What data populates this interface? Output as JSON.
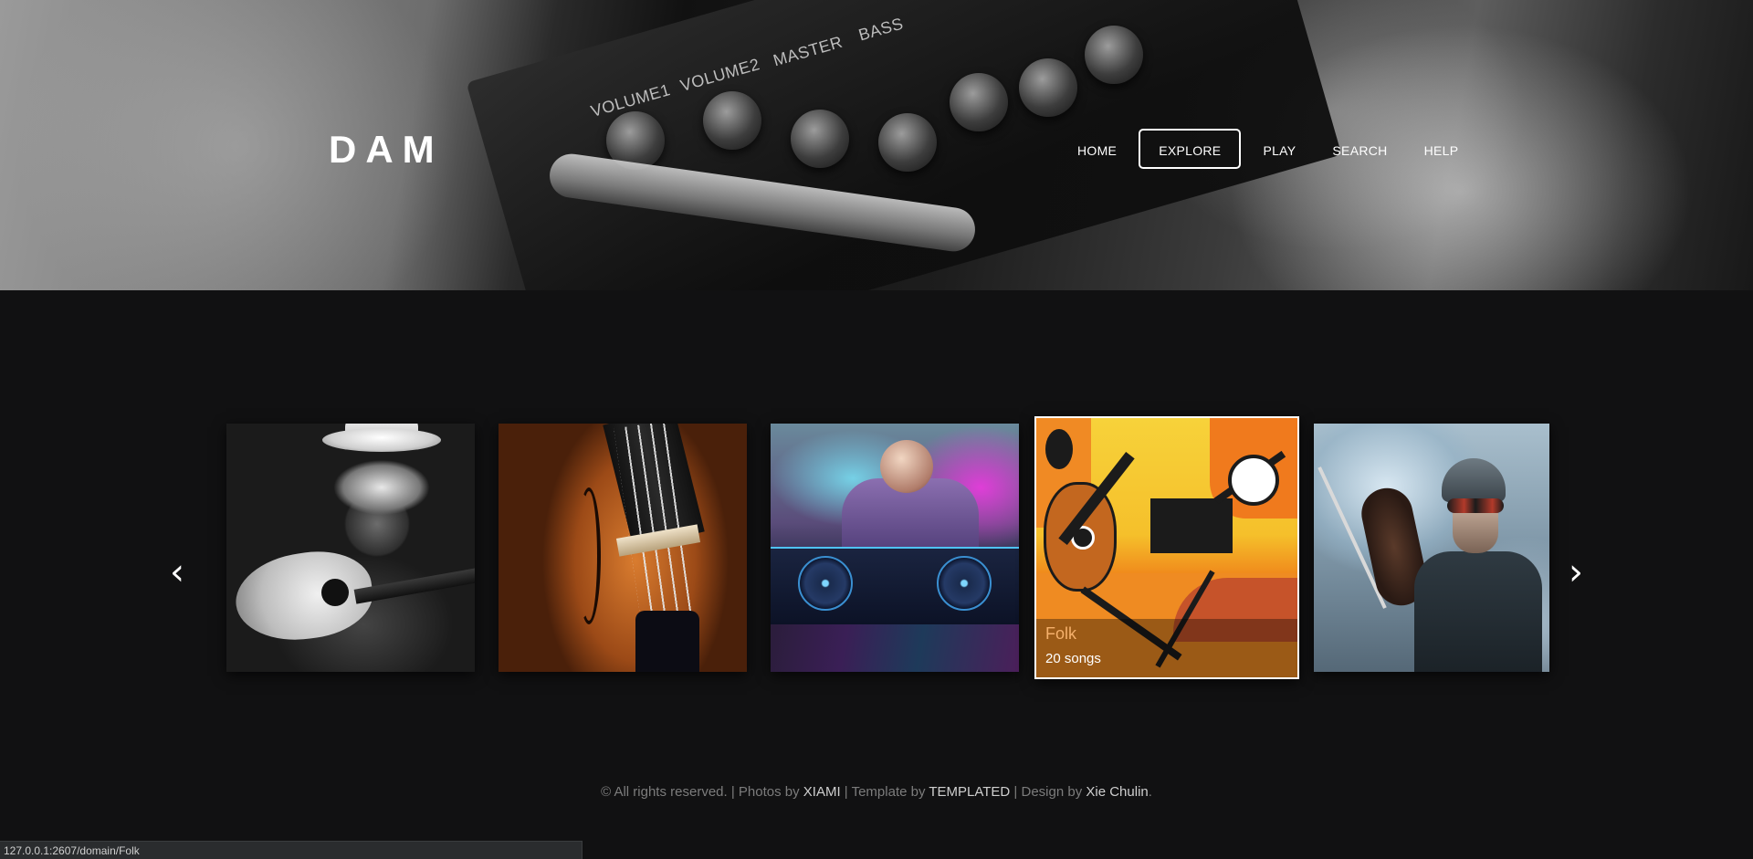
{
  "header": {
    "logo": "DAM",
    "knob_labels": [
      "VOLUME1",
      "VOLUME2",
      "MASTER",
      "BASS"
    ],
    "nav": [
      {
        "label": "HOME",
        "active": false
      },
      {
        "label": "EXPLORE",
        "active": true
      },
      {
        "label": "PLAY",
        "active": false
      },
      {
        "label": "SEARCH",
        "active": false
      },
      {
        "label": "HELP",
        "active": false
      }
    ]
  },
  "carousel": {
    "prev_icon": "chevron-left-icon",
    "next_icon": "chevron-right-icon",
    "prev_glyph": "‹",
    "next_glyph": "›",
    "cards": [
      {
        "image": "blues-guitarist"
      },
      {
        "image": "violin-closeup"
      },
      {
        "image": "dj-decks"
      },
      {
        "image": "folk-illustration",
        "genre": "Folk",
        "count": "20 songs",
        "active": true
      },
      {
        "image": "soldier-violinist"
      }
    ]
  },
  "footer": {
    "copyright": "© All rights reserved.",
    "photos_prefix": " | Photos by ",
    "photos_link": "XIAMI",
    "template_prefix": " | Template by ",
    "template_link": "TEMPLATED",
    "design_prefix": " | Design by ",
    "design_link": "Xie Chulin",
    "suffix": "."
  },
  "statusbar": {
    "url": "127.0.0.1:2607/domain/Folk"
  },
  "colors": {
    "background": "#111112",
    "genre_accent": "#f5b06b",
    "active_border": "#ffffff"
  }
}
